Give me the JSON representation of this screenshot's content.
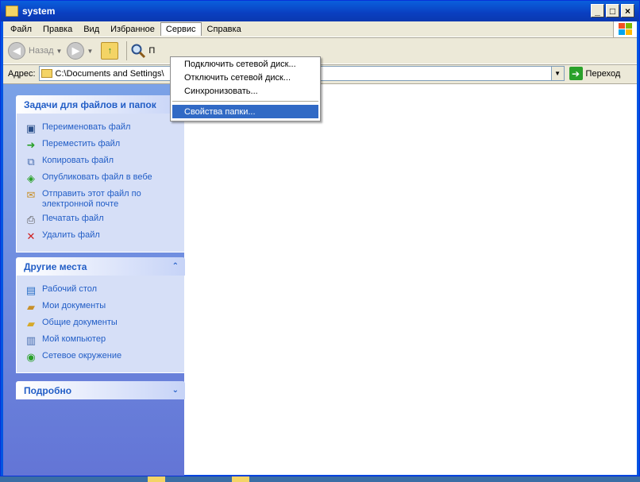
{
  "window": {
    "title": "system"
  },
  "menubar": {
    "items": [
      "Файл",
      "Правка",
      "Вид",
      "Избранное",
      "Сервис",
      "Справка"
    ]
  },
  "toolbar": {
    "back_label": "Назад",
    "search_label": "П"
  },
  "addressbar": {
    "label": "Адрес:",
    "value": "C:\\Documents and Settings\\",
    "go_label": "Переход"
  },
  "dropdown": {
    "items": [
      "Подключить сетевой диск...",
      "Отключить сетевой диск...",
      "Синхронизовать...",
      "Свойства папки..."
    ]
  },
  "panels": {
    "file_tasks": {
      "title": "Задачи для файлов и папок",
      "items": [
        "Переименовать файл",
        "Переместить файл",
        "Копировать файл",
        "Опубликовать файл в вебе",
        "Отправить этот файл по электронной почте",
        "Печатать файл",
        "Удалить файл"
      ]
    },
    "other_places": {
      "title": "Другие места",
      "items": [
        "Рабочий стол",
        "Мои документы",
        "Общие документы",
        "Мой компьютер",
        "Сетевое окружение"
      ]
    },
    "details": {
      "title": "Подробно"
    }
  },
  "colors": {
    "accent": "#215dc6",
    "highlight": "#316ac5",
    "title_bar": "#0a3fc0"
  }
}
